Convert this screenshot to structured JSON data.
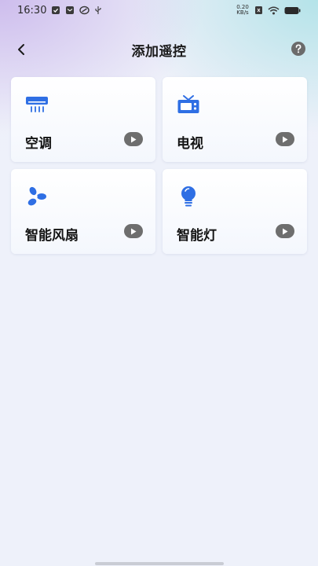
{
  "status_bar": {
    "time": "16:30",
    "net_speed_value": "0.20",
    "net_speed_unit": "KB/s"
  },
  "header": {
    "title": "添加遥控"
  },
  "devices": [
    {
      "label": "空调",
      "icon": "air-conditioner-icon"
    },
    {
      "label": "电视",
      "icon": "tv-icon"
    },
    {
      "label": "智能风扇",
      "icon": "fan-icon"
    },
    {
      "label": "智能灯",
      "icon": "lightbulb-icon"
    }
  ],
  "colors": {
    "accent": "#2f6fe4",
    "play_button": "#6e6e6e",
    "help_button": "#6b6b6b"
  }
}
